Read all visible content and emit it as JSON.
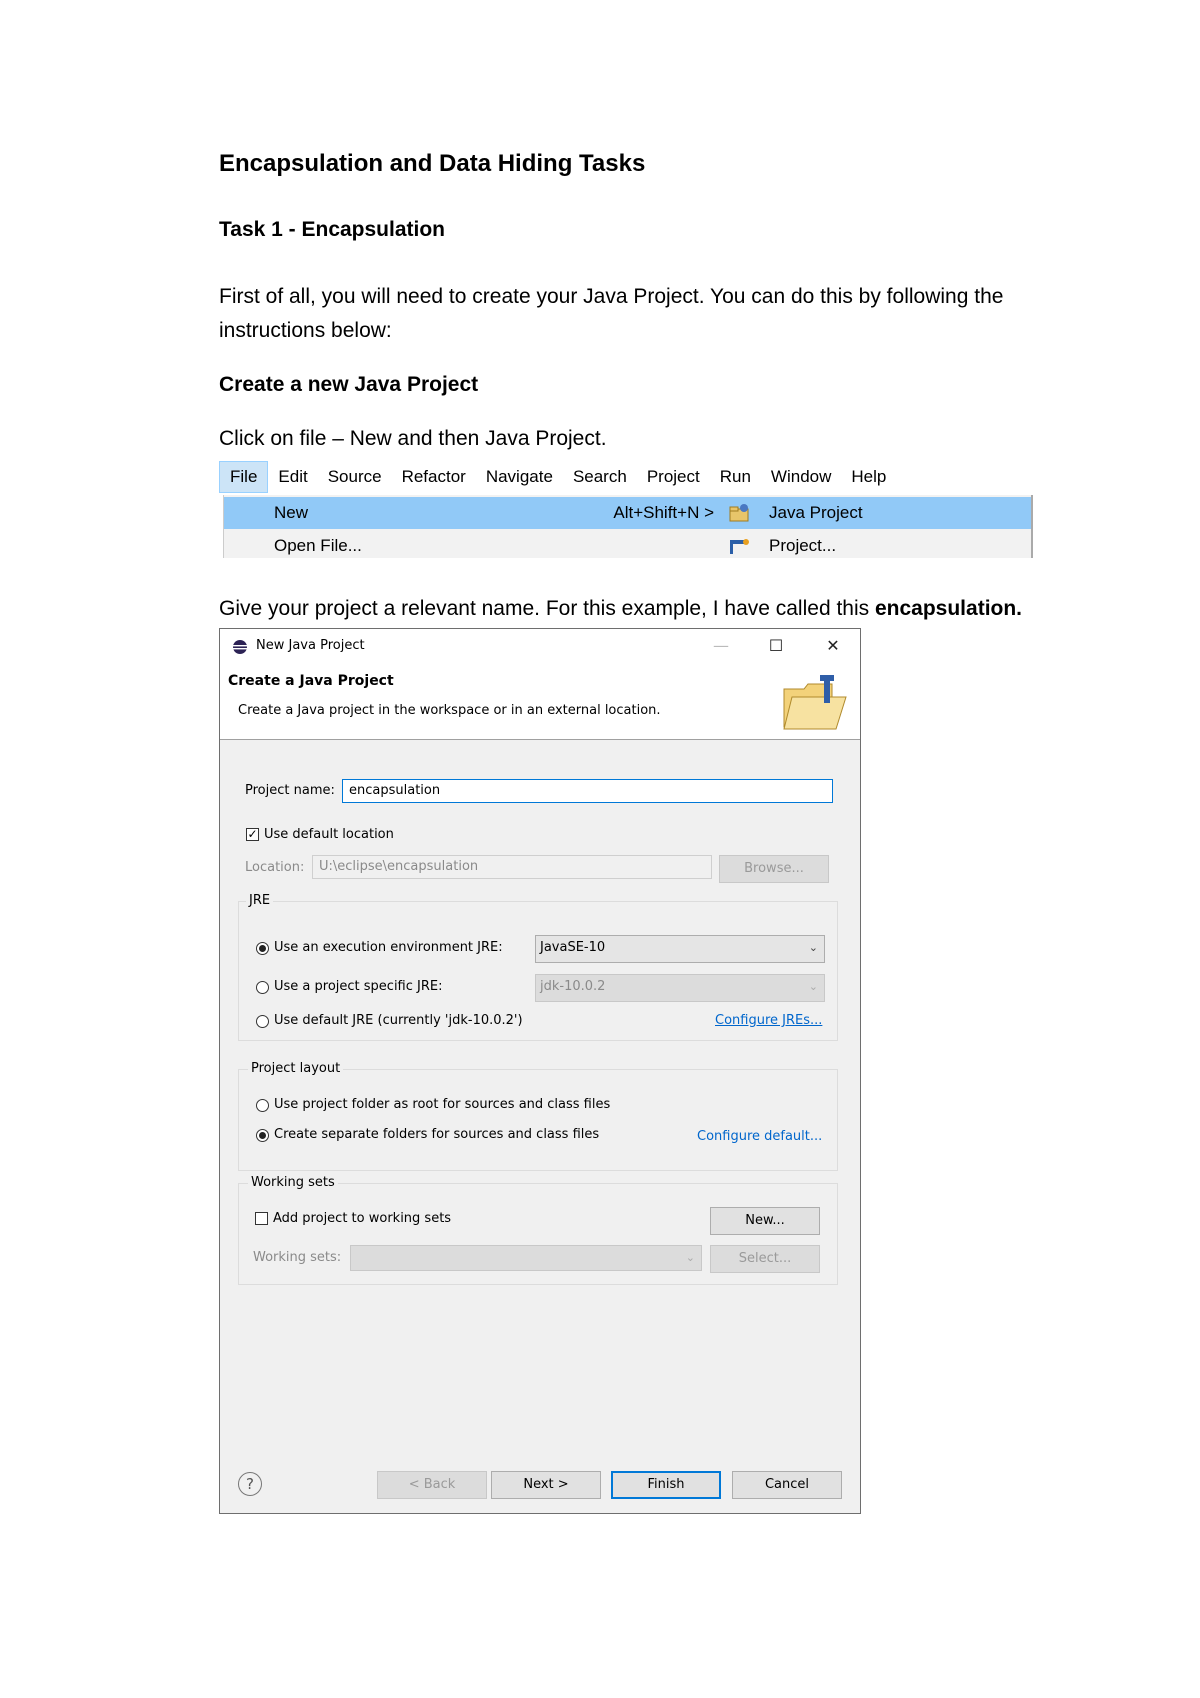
{
  "document": {
    "title": "Encapsulation and Data Hiding Tasks",
    "task_heading": "Task 1 - Encapsulation",
    "intro_line1": "First of all, you will need to create your Java Project. You can do this by following the",
    "intro_line2": "instructions below:",
    "section_heading": "Create a new Java Project",
    "step1": "Click on file – New and then Java Project.",
    "step2_prefix": "Give your project a relevant name. For this example, I have called this ",
    "step2_bold": "encapsulation."
  },
  "menu_screenshot": {
    "menubar": [
      "File",
      "Edit",
      "Source",
      "Refactor",
      "Navigate",
      "Search",
      "Project",
      "Run",
      "Window",
      "Help"
    ],
    "file_menu": [
      {
        "label": "New",
        "shortcut": "Alt+Shift+N >",
        "highlighted": true
      },
      {
        "label": "Open File...",
        "shortcut": "",
        "highlighted": false
      }
    ],
    "new_submenu": [
      {
        "label": "Java Project",
        "icon": "java-project-icon",
        "highlighted": true
      },
      {
        "label": "Project...",
        "icon": "project-icon",
        "highlighted": false
      }
    ]
  },
  "dialog": {
    "window_title": "New Java Project",
    "header_title": "Create a Java Project",
    "header_desc": "Create a Java project in the workspace or in an external location.",
    "project_name_label": "Project name:",
    "project_name_value": "encapsulation",
    "use_default_location_label": "Use default location",
    "use_default_location_checked": true,
    "location_label": "Location:",
    "location_value": "U:\\eclipse\\encapsulation",
    "browse_label": "Browse...",
    "jre": {
      "group_label": "JRE",
      "option_execution_env": "Use an execution environment JRE:",
      "execution_env_value": "JavaSE-10",
      "option_project_specific": "Use a project specific JRE:",
      "project_specific_value": "jdk-10.0.2",
      "option_default": "Use default JRE (currently 'jdk-10.0.2')",
      "configure_link": "Configure JREs...",
      "selected": "execution_env"
    },
    "layout": {
      "group_label": "Project layout",
      "option_root": "Use project folder as root for sources and class files",
      "option_separate": "Create separate folders for sources and class files",
      "configure_link": "Configure default...",
      "selected": "separate"
    },
    "working_sets": {
      "group_label": "Working sets",
      "add_label": "Add project to working sets",
      "add_checked": false,
      "new_button": "New...",
      "sets_label": "Working sets:",
      "select_button": "Select..."
    },
    "buttons": {
      "help": "?",
      "back": "< Back",
      "next": "Next >",
      "finish": "Finish",
      "cancel": "Cancel"
    },
    "colors": {
      "accent": "#0078d7",
      "highlight": "#91c9f7",
      "link": "#0066cc"
    }
  }
}
